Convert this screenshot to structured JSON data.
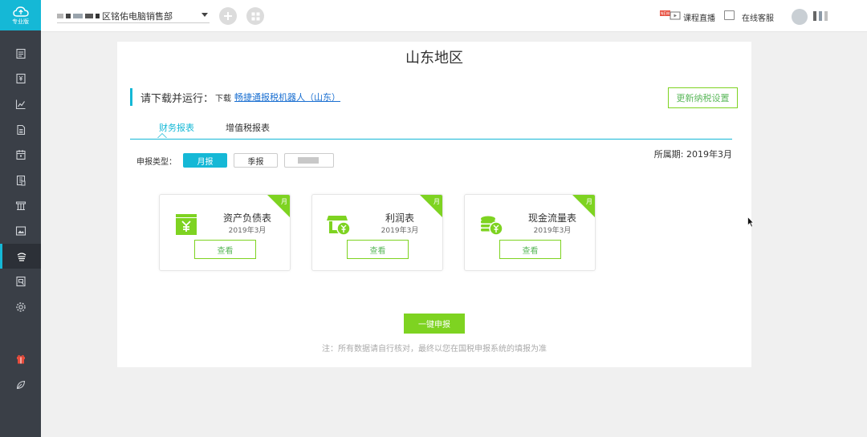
{
  "sidebar": {
    "logo_label": "专业版",
    "items": [
      "invoice-icon",
      "receipt-icon",
      "chart-icon",
      "document-icon",
      "calendar-icon",
      "archive-icon",
      "building-icon",
      "image-icon",
      "tax-icon",
      "report-icon",
      "settings-icon"
    ],
    "bottom_items": [
      "gift-icon",
      "leaf-icon"
    ],
    "accent": "#15b8d6"
  },
  "header": {
    "company_name": "区铭佑电脑销售部",
    "live_badge": "NEW",
    "live_label": "课程直播",
    "service_label": "在线客服"
  },
  "main": {
    "title": "山东地区",
    "download_lead": "请下载并运行：",
    "download_prefix": "下载",
    "download_link": "畅捷通报税机器人（山东）",
    "update_button": "更新纳税设置",
    "tabs": [
      "财务报表",
      "增值税报表"
    ],
    "active_tab": "财务报表",
    "period": "所属期: 2019年3月",
    "report_type_label": "申报类型：",
    "report_types": [
      "月报",
      "季报"
    ],
    "active_report_type": "月报",
    "cards": [
      {
        "name": "资产负债表",
        "date": "2019年3月",
        "badge": "月",
        "button": "查看",
        "icon": "wallet-yen-icon"
      },
      {
        "name": "利润表",
        "date": "2019年3月",
        "badge": "月",
        "button": "查看",
        "icon": "shop-yen-icon"
      },
      {
        "name": "现金流量表",
        "date": "2019年3月",
        "badge": "月",
        "button": "查看",
        "icon": "coins-yen-icon"
      }
    ],
    "submit_button": "一键申报",
    "note": "注：所有数据请自行核对，最终以您在国税申报系统的填报为准",
    "green": "#7ed321"
  }
}
